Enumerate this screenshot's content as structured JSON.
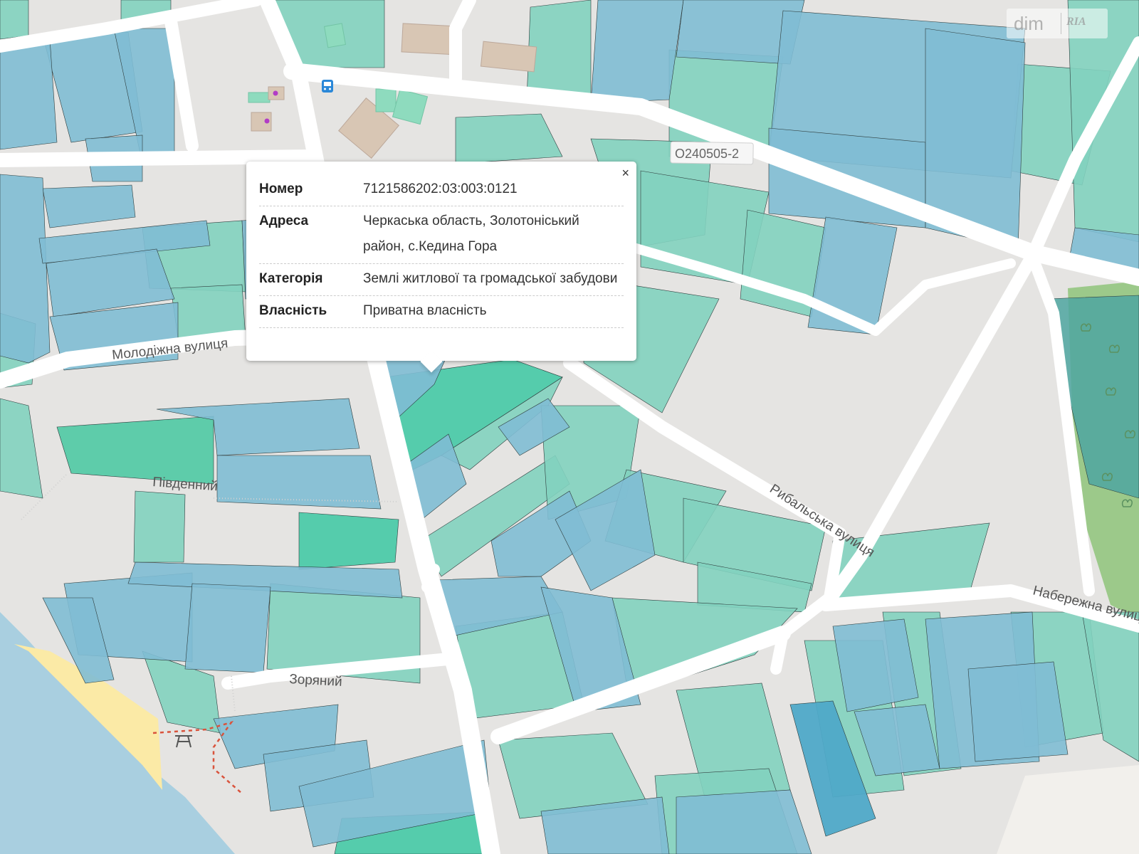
{
  "map": {
    "street_labels": {
      "molodizhna": "Молодіжна вулиця",
      "rybalska": "Рибальська вулиця",
      "naberezhna": "Набережна вулиця",
      "pivdennyi": "Південний",
      "zorianyi": "Зоряний",
      "road_ref": "O240505-2"
    },
    "colors": {
      "background": "#e5e4e2",
      "road": "#ffffff",
      "parcel_blue": "#7fbdd4",
      "parcel_teal": "#82d2bf",
      "parcel_selected": "#45c9a6",
      "water": "#a9cfe0",
      "sand": "#fbeaa6",
      "forest": "#9cc98a"
    },
    "icons": [
      "bus-stop-icon",
      "picnic-table-icon"
    ]
  },
  "popup": {
    "close_label": "×",
    "rows": [
      {
        "key": "Номер",
        "value": "7121586202:03:003:0121"
      },
      {
        "key": "Адреса",
        "value": "Черкаська область, Золотоніський район, с.Кедина Гора"
      },
      {
        "key": "Категорія",
        "value": "Землі житлової та громадської забудови"
      },
      {
        "key": "Власність",
        "value": "Приватна власність"
      }
    ]
  },
  "watermark": {
    "dim": "dim",
    "ria": "RIA"
  }
}
